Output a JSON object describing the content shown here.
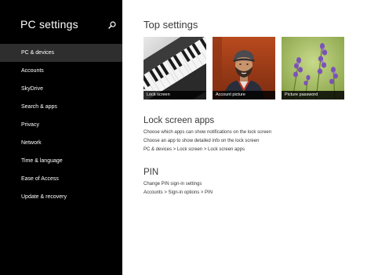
{
  "sidebar": {
    "title": "PC settings",
    "search_icon": "search-icon",
    "items": [
      {
        "label": "PC & devices",
        "selected": true
      },
      {
        "label": "Accounts",
        "selected": false
      },
      {
        "label": "SkyDrive",
        "selected": false
      },
      {
        "label": "Search & apps",
        "selected": false
      },
      {
        "label": "Privacy",
        "selected": false
      },
      {
        "label": "Network",
        "selected": false
      },
      {
        "label": "Time & language",
        "selected": false
      },
      {
        "label": "Ease of Access",
        "selected": false
      },
      {
        "label": "Update & recovery",
        "selected": false
      }
    ]
  },
  "main": {
    "title": "Top settings",
    "tiles": [
      {
        "label": "Lock screen",
        "image": "piano-keys"
      },
      {
        "label": "Account picture",
        "image": "person-portrait"
      },
      {
        "label": "Picture password",
        "image": "purple-flowers"
      }
    ],
    "lock_screen_apps": {
      "title": "Lock screen apps",
      "links": [
        "Choose which apps can show notifications on the lock screen",
        "Choose an app to show detailed info on the lock screen",
        "PC & devices > Lock screen > Lock screen apps"
      ]
    },
    "pin": {
      "title": "PIN",
      "links": [
        "Change PIN sign-in settings",
        "Accounts > Sign-in options > PIN"
      ]
    }
  },
  "colors": {
    "sidebar_bg": "#000000",
    "sidebar_selected_bg": "#2e2e2e",
    "main_bg": "#ffffff",
    "text_dark": "#3a3a3a"
  }
}
